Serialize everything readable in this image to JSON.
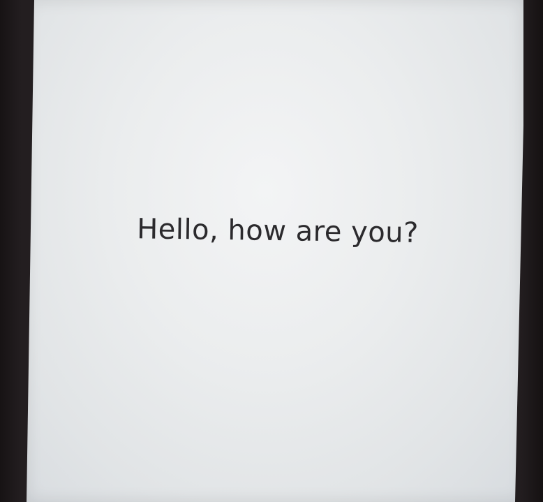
{
  "screen": {
    "message": "Hello, how are you?"
  },
  "colors": {
    "bezel": "#1e1a1c",
    "screen": "#ebedee",
    "text": "#2b2a2d"
  }
}
